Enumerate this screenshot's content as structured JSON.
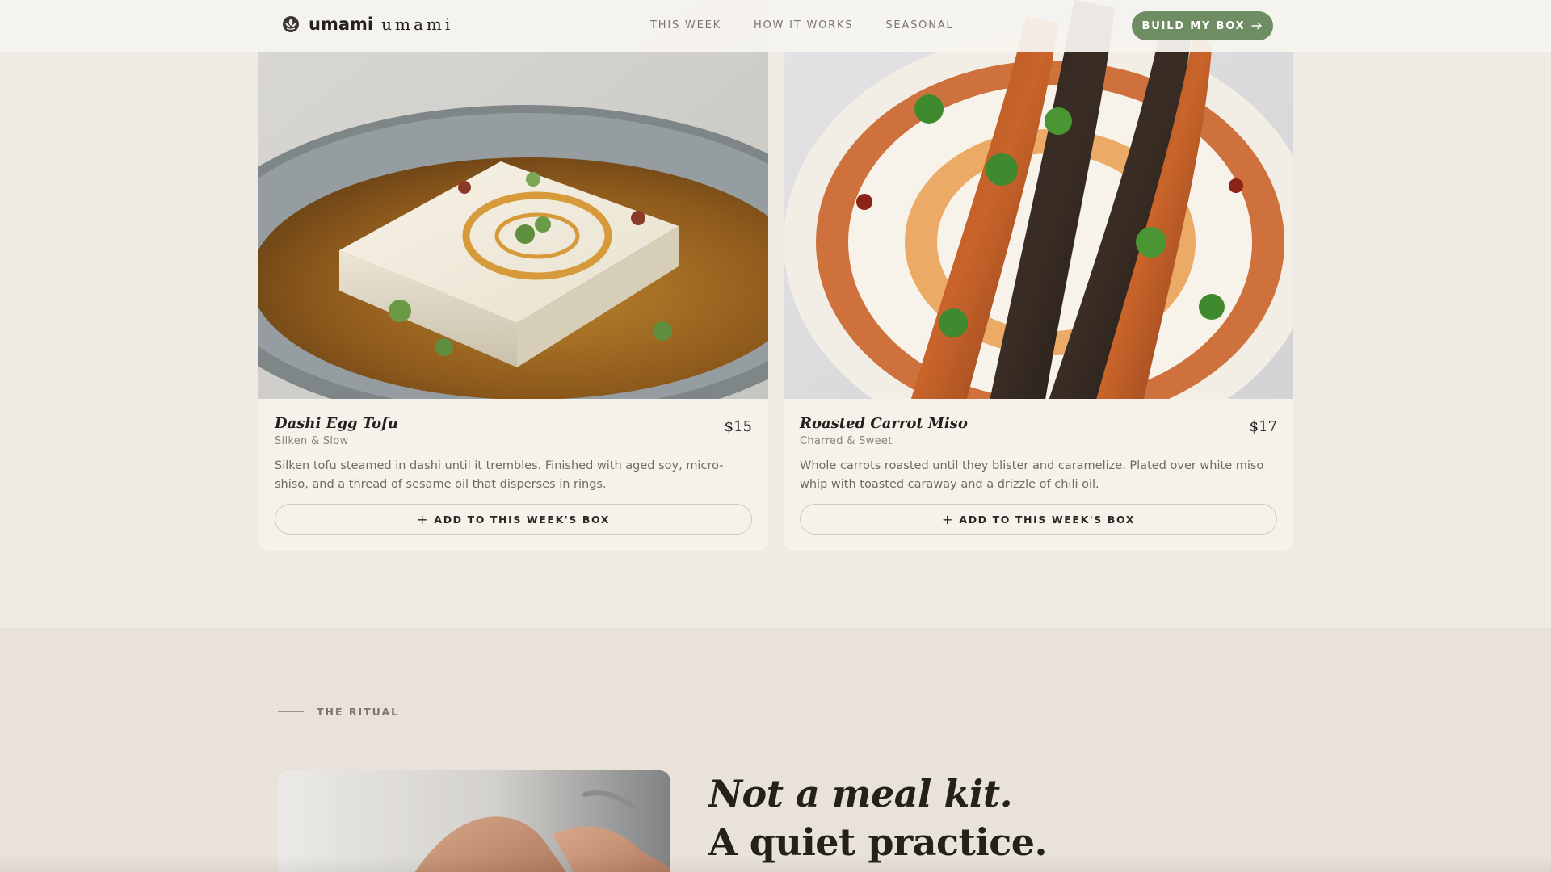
{
  "brand": {
    "name": "umami",
    "tagline": "umami"
  },
  "nav": {
    "links": [
      "THIS WEEK",
      "HOW IT WORKS",
      "SEASONAL"
    ],
    "cta_label": "BUILD MY BOX",
    "cta_icon": "arrow-right-icon"
  },
  "dishes": [
    {
      "title": "Dashi Egg Tofu",
      "subtitle": "Silken & Slow",
      "price": "$15",
      "description": "Silken tofu steamed in dashi until it trembles. Finished with aged soy, micro-shiso, and a thread of sesame oil that disperses in rings.",
      "add_label": "ADD TO THIS WEEK'S BOX"
    },
    {
      "title": "Roasted Carrot Miso",
      "subtitle": "Charred & Sweet",
      "price": "$17",
      "description": "Whole carrots roasted until they blister and caramelize. Plated over white miso whip with toasted caraway and a drizzle of chili oil.",
      "add_label": "ADD TO THIS WEEK'S BOX"
    }
  ],
  "ritual": {
    "eyebrow": "THE RITUAL",
    "headline_line1": "Not a meal kit.",
    "headline_line2": "A quiet practice."
  },
  "colors": {
    "accent_green": "#6f8d63",
    "page_bg": "#efebe4",
    "section_bg": "#e8e2d8",
    "card_bg": "#f5f2ec"
  }
}
